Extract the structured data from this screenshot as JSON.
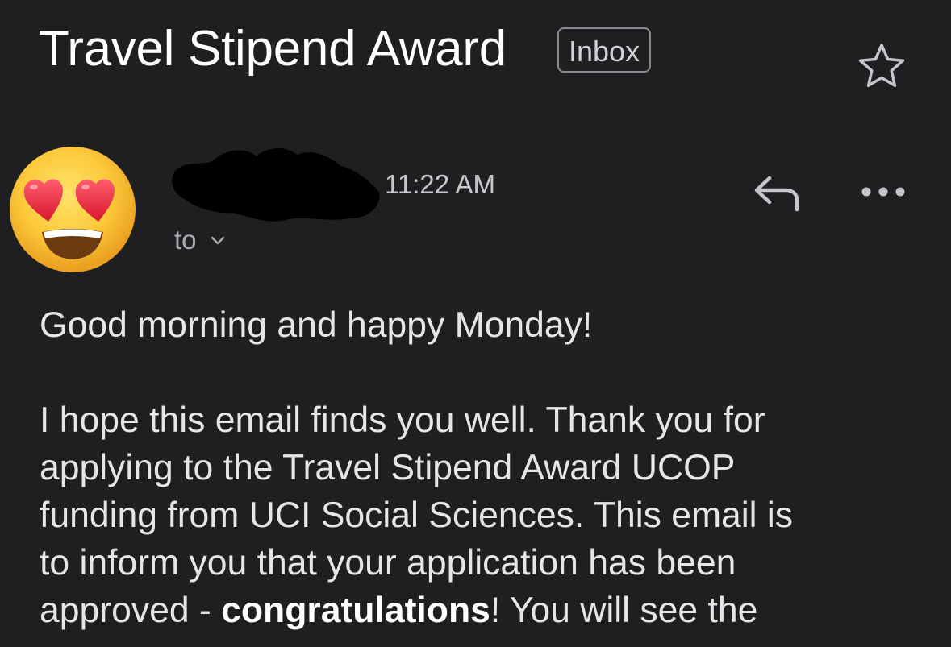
{
  "email": {
    "subject": "Travel Stipend Award",
    "label": "Inbox",
    "time": "11:22 AM",
    "to_label": "to",
    "greeting": "Good morning and happy Monday!",
    "body_lines": [
      "I hope this email finds you well. Thank you for",
      "applying to the Travel Stipend Award UCOP",
      "funding from UCI Social Sciences. This email is",
      "to inform you that your application has been"
    ],
    "last_line_before": "approved - ",
    "last_line_bold": "congratulations",
    "last_line_after": "! You will see the"
  },
  "icons": {
    "star": "star-outline-icon",
    "reply": "reply-arrow-icon",
    "more": "more-horizontal-icon",
    "chevron": "chevron-down-icon",
    "avatar": "heart-eyes-emoji"
  },
  "colors": {
    "background": "#1f1f22",
    "text_primary": "#ffffff",
    "text_secondary": "#a9a9ae",
    "chip_border": "#8a8a8f"
  }
}
